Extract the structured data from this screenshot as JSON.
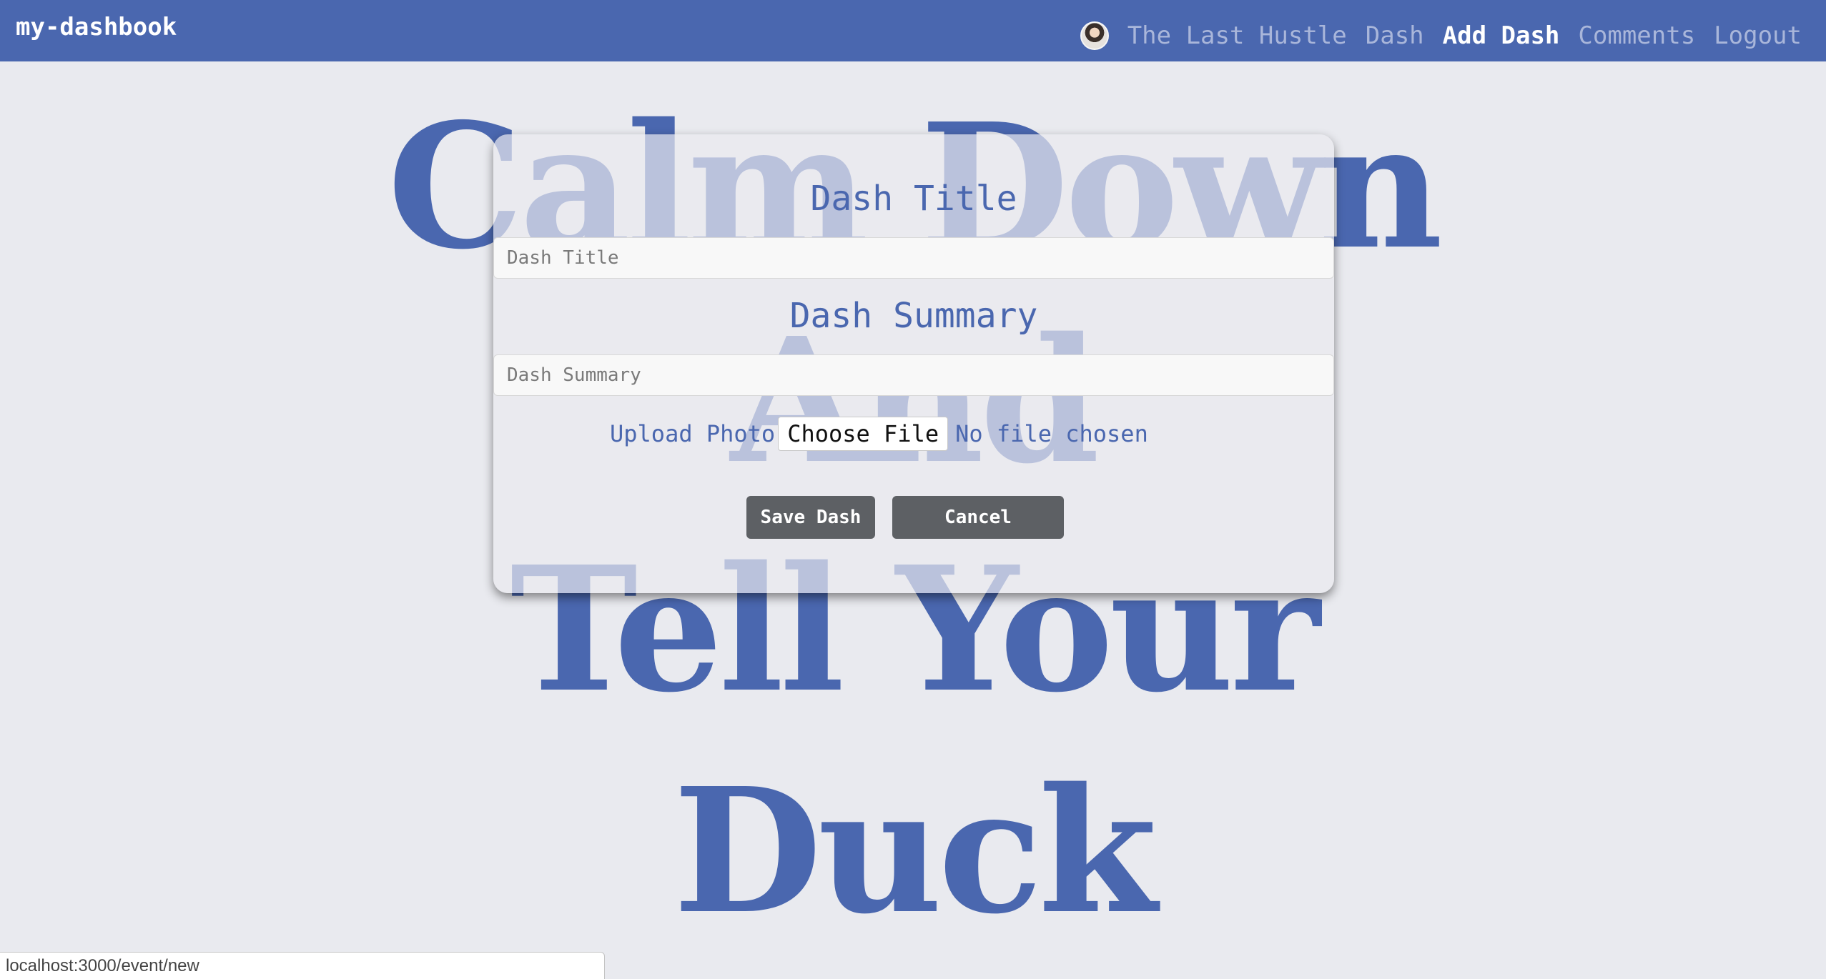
{
  "navbar": {
    "brand": "my-dashbook",
    "links": [
      {
        "label": "The Last Hustle",
        "active": false
      },
      {
        "label": "Dash",
        "active": false
      },
      {
        "label": "Add Dash",
        "active": true
      },
      {
        "label": "Comments",
        "active": false
      },
      {
        "label": "Logout",
        "active": false
      }
    ]
  },
  "hero": {
    "lines": [
      "Calm Down",
      "And",
      "Tell Your",
      "Duck"
    ]
  },
  "form": {
    "title_label": "Dash Title",
    "title_placeholder": "Dash Title",
    "summary_label": "Dash Summary",
    "summary_placeholder": "Dash Summary",
    "upload_label": "Upload Photo",
    "choose_file_label": "Choose File",
    "no_file_text": "No file chosen",
    "save_label": "Save Dash",
    "cancel_label": "Cancel"
  },
  "status_bar": {
    "url": "localhost:3000/event/new"
  },
  "colors": {
    "navbar": "#4a67af",
    "accent": "#4a67af",
    "background": "#e9eaef",
    "button": "#5d6064"
  }
}
